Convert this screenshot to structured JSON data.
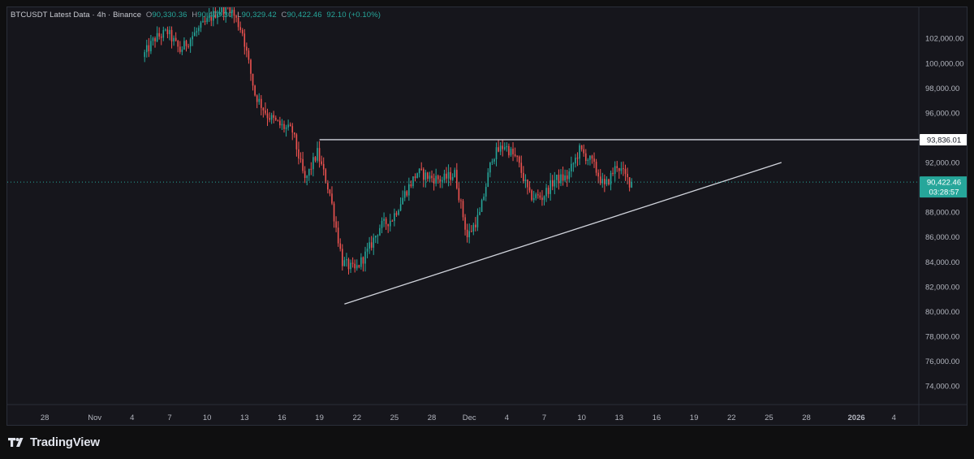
{
  "legend": {
    "symbol": "BTCUSDT Latest Data · 4h · Binance",
    "o_label": "O",
    "o_value": "90,330.36",
    "h_label": "H",
    "h_value": "90,470.30",
    "l_label": "L",
    "l_value": "90,329.42",
    "c_label": "C",
    "c_value": "90,422.46",
    "change": "92.10 (+0.10%)"
  },
  "brand": {
    "name": "TradingView"
  },
  "colors": {
    "up": "#26a69a",
    "down": "#ef5350",
    "background": "#16161c",
    "axis_text": "#b2b5be",
    "trendline": "#d1d4dc",
    "last_price": "#26a69a"
  },
  "chart_data": {
    "type": "candlestick",
    "title": "BTCUSDT Latest Data · 4h · Binance",
    "ylim": [
      72500,
      104500
    ],
    "y_ticks": [
      74000,
      76000,
      78000,
      80000,
      82000,
      84000,
      86000,
      88000,
      90000,
      92000,
      94000,
      96000,
      98000,
      100000,
      102000
    ],
    "y_tick_labels": [
      "74,000.00",
      "76,000.00",
      "78,000.00",
      "80,000.00",
      "82,000.00",
      "84,000.00",
      "86,000.00",
      "88,000.00",
      "90,000.00",
      "92,000.00",
      "94,000.00",
      "96,000.00",
      "98,000.00",
      "100,000.00",
      "102,000.00"
    ],
    "x_range": [
      "2025-10-25",
      "2026-01-06"
    ],
    "x_ticks": [
      {
        "date": "2025-10-28",
        "label": "28"
      },
      {
        "date": "2025-11-01",
        "label": "Nov"
      },
      {
        "date": "2025-11-04",
        "label": "4"
      },
      {
        "date": "2025-11-07",
        "label": "7"
      },
      {
        "date": "2025-11-10",
        "label": "10"
      },
      {
        "date": "2025-11-13",
        "label": "13"
      },
      {
        "date": "2025-11-16",
        "label": "16"
      },
      {
        "date": "2025-11-19",
        "label": "19"
      },
      {
        "date": "2025-11-22",
        "label": "22"
      },
      {
        "date": "2025-11-25",
        "label": "25"
      },
      {
        "date": "2025-11-28",
        "label": "28"
      },
      {
        "date": "2025-12-01",
        "label": "Dec"
      },
      {
        "date": "2025-12-04",
        "label": "4"
      },
      {
        "date": "2025-12-07",
        "label": "7"
      },
      {
        "date": "2025-12-10",
        "label": "10"
      },
      {
        "date": "2025-12-13",
        "label": "13"
      },
      {
        "date": "2025-12-16",
        "label": "16"
      },
      {
        "date": "2025-12-19",
        "label": "19"
      },
      {
        "date": "2025-12-22",
        "label": "22"
      },
      {
        "date": "2025-12-25",
        "label": "25"
      },
      {
        "date": "2025-12-28",
        "label": "28"
      },
      {
        "date": "2026-01-01",
        "label": "2026"
      },
      {
        "date": "2026-01-04",
        "label": "4"
      }
    ],
    "price_path": [
      [
        "2025-11-05",
        100500
      ],
      [
        "2025-11-06",
        102000
      ],
      [
        "2025-11-07",
        102500
      ],
      [
        "2025-11-08",
        101000
      ],
      [
        "2025-11-09",
        102200
      ],
      [
        "2025-11-10",
        103200
      ],
      [
        "2025-11-11",
        104200
      ],
      [
        "2025-11-12",
        104500
      ],
      [
        "2025-11-13",
        102500
      ],
      [
        "2025-11-14",
        97500
      ],
      [
        "2025-11-15",
        95800
      ],
      [
        "2025-11-16",
        95000
      ],
      [
        "2025-11-17",
        94500
      ],
      [
        "2025-11-18",
        90500
      ],
      [
        "2025-11-19",
        92800
      ],
      [
        "2025-11-20",
        89500
      ],
      [
        "2025-11-21",
        84000
      ],
      [
        "2025-11-22",
        83300
      ],
      [
        "2025-11-23",
        84800
      ],
      [
        "2025-11-24",
        86800
      ],
      [
        "2025-11-25",
        87500
      ],
      [
        "2025-11-26",
        89500
      ],
      [
        "2025-11-27",
        91200
      ],
      [
        "2025-11-28",
        90800
      ],
      [
        "2025-11-29",
        90600
      ],
      [
        "2025-11-30",
        91100
      ],
      [
        "2025-12-01",
        86000
      ],
      [
        "2025-12-02",
        87800
      ],
      [
        "2025-12-03",
        92500
      ],
      [
        "2025-12-04",
        93400
      ],
      [
        "2025-12-05",
        92200
      ],
      [
        "2025-12-06",
        89300
      ],
      [
        "2025-12-07",
        89200
      ],
      [
        "2025-12-08",
        90600
      ],
      [
        "2025-12-09",
        90800
      ],
      [
        "2025-12-10",
        93000
      ],
      [
        "2025-12-11",
        92000
      ],
      [
        "2025-12-12",
        90000
      ],
      [
        "2025-12-13",
        91800
      ],
      [
        "2025-12-14",
        90422.46
      ]
    ],
    "annotations": {
      "resistance": {
        "y": 93836.01,
        "x0": "2025-11-19",
        "x1": "2026-01-06",
        "label": "93,836.01"
      },
      "ascending_trendline": {
        "start": [
          "2025-11-21",
          80600
        ],
        "end": [
          "2025-12-26",
          92000
        ]
      },
      "last_price": {
        "value": 90422.46,
        "label": "90,422.46",
        "countdown": "03:28:57"
      }
    }
  }
}
